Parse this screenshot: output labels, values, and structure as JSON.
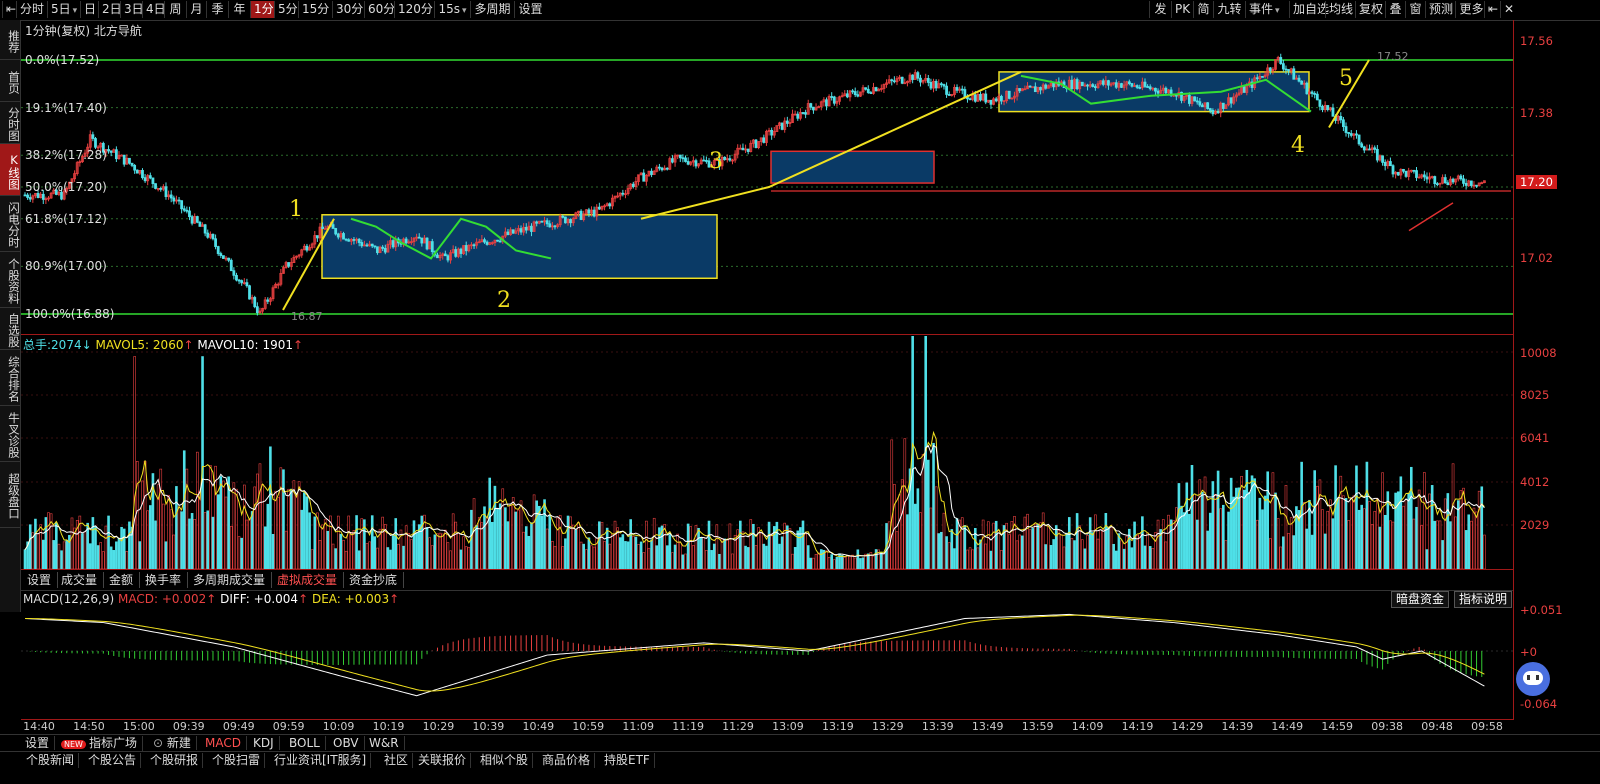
{
  "toolbar": {
    "left_items": [
      "分时",
      "5日",
      "日",
      "2日",
      "3日",
      "4日",
      "周",
      "月",
      "季",
      "年",
      "1分",
      "5分",
      "15分",
      "30分",
      "60分",
      "120分",
      "15s",
      "多周期",
      "设置"
    ],
    "active": "1分",
    "right_items": [
      "发",
      "PK",
      "简",
      "九转",
      "事件",
      "加自选",
      "均线",
      "复权",
      "叠",
      "窗",
      "预测",
      "更多"
    ]
  },
  "sidebar": [
    "推荐",
    "首页",
    "分时图",
    "K线图",
    "闪电分时",
    "个股资料",
    "自选股",
    "综合排名",
    "牛叉诊股",
    "超级盘口"
  ],
  "sidebar_active": "K线图",
  "price": {
    "header": "1分钟(复权) 北方导航",
    "fib_levels": [
      {
        "label": "0.0%(17.52)",
        "price": 17.52
      },
      {
        "label": "19.1%(17.40)",
        "price": 17.4
      },
      {
        "label": "38.2%(17.28)",
        "price": 17.28
      },
      {
        "label": "50.0%(17.20)",
        "price": 17.2
      },
      {
        "label": "61.8%(17.12)",
        "price": 17.12
      },
      {
        "label": "80.9%(17.00)",
        "price": 17.0
      },
      {
        "label": "100.0%(16.88)",
        "price": 16.88
      }
    ],
    "y_ticks": [
      "17.56",
      "17.38",
      "17.02"
    ],
    "current_price": "17.20",
    "high_label": "17.52",
    "low_label": "16.87",
    "annotations": [
      "1",
      "2",
      "3",
      "4",
      "5"
    ]
  },
  "volume": {
    "header": {
      "total_label": "总手:",
      "total": "2074",
      "ma5_label": "MAVOL5:",
      "ma5": "2060",
      "ma10_label": "MAVOL10:",
      "ma10": "1901"
    },
    "y_ticks": [
      "10008",
      "8025",
      "6041",
      "4012",
      "2029"
    ]
  },
  "vol_tabs": [
    "设置",
    "成交量",
    "金额",
    "换手率",
    "多周期成交量",
    "虚拟成交量",
    "资金抄底"
  ],
  "vol_tabs_active": "虚拟成交量",
  "macd": {
    "header": {
      "name": "MACD(12,26,9)",
      "macd_label": "MACD:",
      "macd": "+0.002",
      "diff_label": "DIFF:",
      "diff": "+0.004",
      "dea_label": "DEA:",
      "dea": "+0.003"
    },
    "y_ticks": [
      "+0.051",
      "+0",
      "-0.064"
    ],
    "buttons": [
      "暗盘资金",
      "指标说明"
    ]
  },
  "time_axis": [
    "14:40",
    "14:50",
    "15:00",
    "09:39",
    "09:49",
    "09:59",
    "10:09",
    "10:19",
    "10:29",
    "10:39",
    "10:49",
    "10:59",
    "11:09",
    "11:19",
    "11:29",
    "13:09",
    "13:19",
    "13:29",
    "13:39",
    "13:49",
    "13:59",
    "14:09",
    "14:19",
    "14:29",
    "14:39",
    "14:49",
    "14:59",
    "09:38",
    "09:48",
    "09:58"
  ],
  "indicator_tabs": [
    "设置",
    "指标广场",
    "新建",
    "MACD",
    "KDJ",
    "BOLL",
    "OBV",
    "W&R"
  ],
  "indicator_active": "MACD",
  "new_badge": "NEW",
  "news_tabs": [
    "个股新闻",
    "个股公告",
    "个股研报",
    "个股扫雷",
    "行业资讯[IT服务]",
    "社区",
    "关联报价",
    "相似个股",
    "商品价格",
    "持股ETF"
  ],
  "colors": {
    "up": "#e84040",
    "down": "#4fe0e8",
    "fib": "#33dd33",
    "box_border": "#f0e020",
    "box_fill": "#0a3a66",
    "arrow_green": "#33dd33",
    "arrow_yellow": "#f0e020",
    "ma_white": "#ffffff",
    "ma_yellow": "#f0e020"
  }
}
